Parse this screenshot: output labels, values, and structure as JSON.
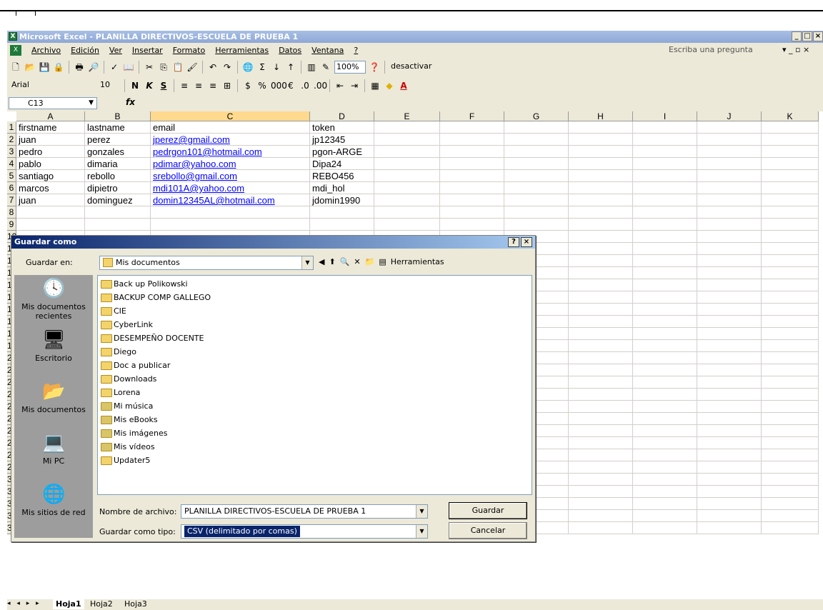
{
  "window": {
    "title": "Microsoft Excel - PLANILLA DIRECTIVOS-ESCUELA DE PRUEBA 1",
    "controls": [
      "_",
      "×"
    ]
  },
  "menu": {
    "items": [
      "Archivo",
      "Edición",
      "Ver",
      "Insertar",
      "Formato",
      "Herramientas",
      "Datos",
      "Ventana",
      "?"
    ],
    "ask_placeholder": "Escriba una pregunta"
  },
  "toolbar1": {
    "zoom": "100%",
    "desactivar": "desactivar"
  },
  "toolbar2": {
    "font": "Arial",
    "size": "10"
  },
  "formula": {
    "cell_ref": "C13",
    "fx": "fx"
  },
  "columns": [
    "A",
    "B",
    "C",
    "D",
    "E",
    "F",
    "G",
    "H",
    "I",
    "J",
    "K"
  ],
  "rows": [
    "1",
    "2",
    "3",
    "4",
    "5",
    "6",
    "7",
    "8",
    "9",
    "10",
    "11",
    "12",
    "13",
    "14",
    "15",
    "16",
    "17",
    "18",
    "19",
    "20",
    "21",
    "22",
    "23",
    "24",
    "25",
    "26",
    "27",
    "28",
    "29",
    "30",
    "31",
    "32",
    "33",
    "34"
  ],
  "cells": [
    [
      "firstname",
      "lastname",
      "email",
      "token"
    ],
    [
      "juan",
      "perez",
      "jperez@gmail.com",
      "jp12345"
    ],
    [
      "pedro",
      "gonzales",
      "pedrgon101@hotmail.com",
      "pgon-ARGE"
    ],
    [
      "pablo",
      "dimaria",
      "pdimar@yahoo.com",
      "Dipa24"
    ],
    [
      "santiago",
      "rebollo",
      "srebollo@gmail.com",
      "REBO456"
    ],
    [
      "marcos",
      "dipietro",
      "mdi101A@yahoo.com",
      "mdi_hol"
    ],
    [
      "juan",
      "dominguez",
      "domin12345AL@hotmail.com",
      "jdomin1990"
    ]
  ],
  "sheets": [
    "Hoja1",
    "Hoja2",
    "Hoja3"
  ],
  "dialog": {
    "title": "Guardar como",
    "help": "?",
    "close": "×",
    "save_in_label": "Guardar en:",
    "save_in_value": "Mis documentos",
    "tools_label": "Herramientas",
    "places": [
      "Mis documentos recientes",
      "Escritorio",
      "Mis documentos",
      "Mi PC",
      "Mis sitios de red"
    ],
    "files": [
      "Back up Polikowski",
      "BACKUP COMP GALLEGO",
      "CIE",
      "CyberLink",
      "DESEMPEÑO DOCENTE",
      "Diego",
      "Doc a publicar",
      "Downloads",
      "Lorena",
      "Mi música",
      "Mis eBooks",
      "Mis imágenes",
      "Mis vídeos",
      "Updater5"
    ],
    "filename_label": "Nombre de archivo:",
    "filename_value": "PLANILLA DIRECTIVOS-ESCUELA DE PRUEBA 1",
    "type_label": "Guardar como tipo:",
    "type_value": "CSV (delimitado por comas)",
    "save_button": "Guardar",
    "cancel_button": "Cancelar"
  }
}
